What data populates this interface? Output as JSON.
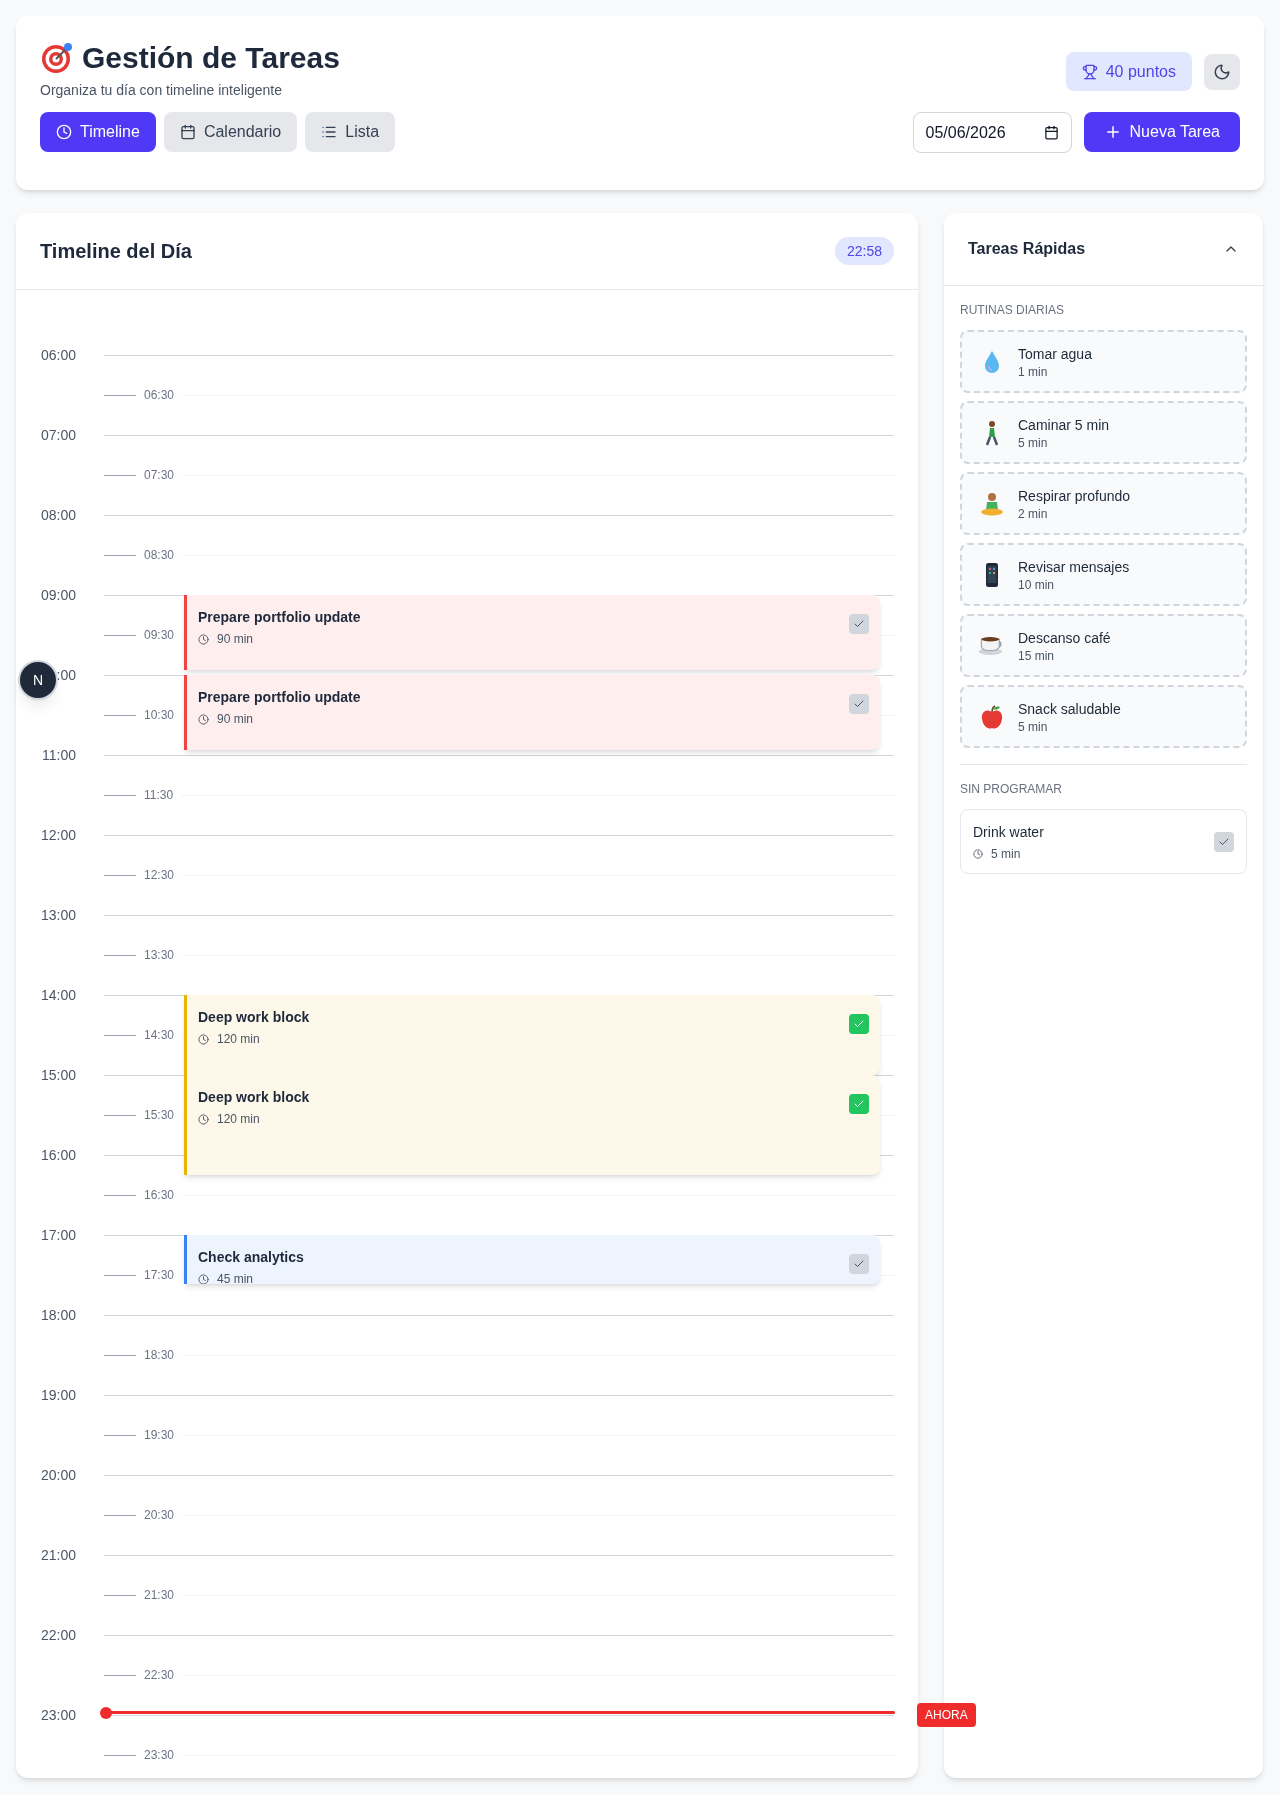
{
  "header": {
    "title": "Gestión de Tareas",
    "subtitle": "Organiza tu día con timeline inteligente",
    "points": "40 puntos"
  },
  "views": [
    {
      "label": "Timeline",
      "selected": true
    },
    {
      "label": "Calendario",
      "selected": false
    },
    {
      "label": "Lista",
      "selected": false
    }
  ],
  "date": "05/06/2026",
  "new_task": "Nueva Tarea",
  "timeline": {
    "title": "Timeline del Día",
    "clock": "22:58",
    "now_label": "AHORA",
    "dev_badge": "N",
    "slots": [
      {
        "kind": "hour",
        "label": "06:00"
      },
      {
        "kind": "half",
        "label": "06:30"
      },
      {
        "kind": "hour",
        "label": "07:00"
      },
      {
        "kind": "half",
        "label": "07:30"
      },
      {
        "kind": "hour",
        "label": "08:00"
      },
      {
        "kind": "half",
        "label": "08:30"
      },
      {
        "kind": "hour",
        "label": "09:00",
        "events": [
          {
            "title": "Prepare portfolio update",
            "duration": "90 min",
            "color": "#ef4444",
            "done": false
          }
        ]
      },
      {
        "kind": "half",
        "label": "09:30"
      },
      {
        "kind": "hour",
        "label": ":00",
        "events": [
          {
            "title": "Prepare portfolio update",
            "duration": "90 min",
            "color": "#ef4444",
            "done": false
          }
        ]
      },
      {
        "kind": "half",
        "label": "10:30"
      },
      {
        "kind": "hour",
        "label": "11:00"
      },
      {
        "kind": "half",
        "label": "11:30"
      },
      {
        "kind": "hour",
        "label": "12:00"
      },
      {
        "kind": "half",
        "label": "12:30"
      },
      {
        "kind": "hour",
        "label": "13:00"
      },
      {
        "kind": "half",
        "label": "13:30"
      },
      {
        "kind": "hour",
        "label": "14:00",
        "events": [
          {
            "title": "Deep work block",
            "duration": "120 min",
            "color": "#eab308",
            "done": true
          }
        ]
      },
      {
        "kind": "half",
        "label": "14:30"
      },
      {
        "kind": "hour",
        "label": "15:00",
        "events": [
          {
            "title": "Deep work block",
            "duration": "120 min",
            "color": "#eab308",
            "done": true
          }
        ]
      },
      {
        "kind": "half",
        "label": "15:30"
      },
      {
        "kind": "hour",
        "label": "16:00"
      },
      {
        "kind": "half",
        "label": "16:30"
      },
      {
        "kind": "hour",
        "label": "17:00",
        "events": [
          {
            "title": "Check analytics",
            "duration": "45 min",
            "color": "#3b82f6",
            "done": false
          }
        ]
      },
      {
        "kind": "half",
        "label": "17:30"
      },
      {
        "kind": "hour",
        "label": "18:00"
      },
      {
        "kind": "half",
        "label": "18:30"
      },
      {
        "kind": "hour",
        "label": "19:00"
      },
      {
        "kind": "half",
        "label": "19:30"
      },
      {
        "kind": "hour",
        "label": "20:00"
      },
      {
        "kind": "half",
        "label": "20:30"
      },
      {
        "kind": "hour",
        "label": "21:00"
      },
      {
        "kind": "half",
        "label": "21:30"
      },
      {
        "kind": "hour",
        "label": "22:00"
      },
      {
        "kind": "half",
        "label": "22:30"
      },
      {
        "kind": "hour",
        "label": "23:00"
      },
      {
        "kind": "half",
        "label": "23:30"
      }
    ]
  },
  "quick": {
    "title": "Tareas Rápidas",
    "expanded": true,
    "routines_heading": "RUTINAS DIARIAS",
    "routines": [
      {
        "name": "Tomar agua",
        "duration": "1 min"
      },
      {
        "name": "Caminar 5 min",
        "duration": "5 min"
      },
      {
        "name": "Respirar profundo",
        "duration": "2 min"
      },
      {
        "name": "Revisar mensajes",
        "duration": "10 min"
      },
      {
        "name": "Descanso café",
        "duration": "15 min"
      },
      {
        "name": "Snack saludable",
        "duration": "5 min"
      }
    ],
    "unscheduled_heading": "SIN PROGRAMAR",
    "unscheduled": [
      {
        "name": "Drink water",
        "duration": "5 min",
        "done": false
      }
    ]
  }
}
